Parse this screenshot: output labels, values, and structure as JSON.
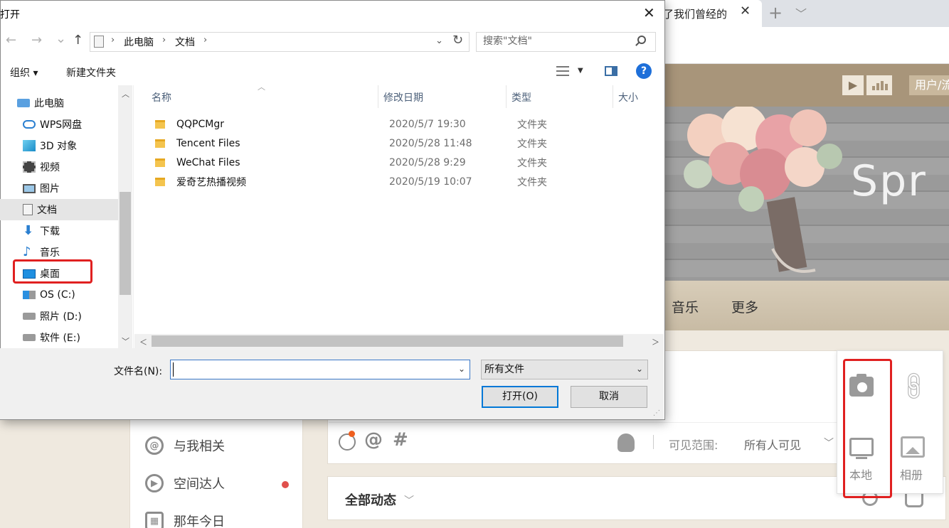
{
  "browser": {
    "tab_title": "了我们曾经的",
    "tab_close": "✕",
    "new_tab": "+",
    "tab_menu": "﹀"
  },
  "qzone": {
    "header_user": "用户/流",
    "banner_text": "Spr",
    "nav": [
      "音乐",
      "更多"
    ],
    "sidebar": [
      {
        "label": "与我相关",
        "icon": "at-icon"
      },
      {
        "label": "空间达人",
        "icon": "play-circle-icon"
      },
      {
        "label": "那年今日",
        "icon": "calendar-icon"
      }
    ],
    "visibility_label": "可见范围:",
    "visibility_value": "所有人可见",
    "feed_title": "全部动态",
    "popup": {
      "local_label": "本地",
      "album_label": "相册"
    },
    "colors": {
      "highlight": "#e02020",
      "header": "#a8957a"
    }
  },
  "dialog": {
    "title": "打开",
    "close": "✕",
    "nav": {
      "back": "←",
      "forward": "→",
      "recent": "⌄",
      "up": "↑"
    },
    "breadcrumb": [
      "此电脑",
      "文档"
    ],
    "breadcrumb_sep": "›",
    "refresh": "↻",
    "search_placeholder": "搜索\"文档\"",
    "toolbar": {
      "organize": "组织 ▾",
      "new_folder": "新建文件夹",
      "help": "?"
    },
    "tree": [
      {
        "label": "此电脑",
        "icon": "computer-icon"
      },
      {
        "label": "WPS网盘",
        "icon": "cloud-icon"
      },
      {
        "label": "3D 对象",
        "icon": "cube-icon"
      },
      {
        "label": "视频",
        "icon": "video-icon"
      },
      {
        "label": "图片",
        "icon": "picture-icon"
      },
      {
        "label": "文档",
        "icon": "document-icon",
        "selected": true
      },
      {
        "label": "下载",
        "icon": "download-icon"
      },
      {
        "label": "音乐",
        "icon": "music-icon"
      },
      {
        "label": "桌面",
        "icon": "desktop-icon"
      },
      {
        "label": "OS (C:)",
        "icon": "windows-drive-icon"
      },
      {
        "label": "照片 (D:)",
        "icon": "drive-icon"
      },
      {
        "label": "软件 (E:)",
        "icon": "drive-icon"
      }
    ],
    "columns": [
      "名称",
      "修改日期",
      "类型",
      "大小"
    ],
    "files": [
      {
        "name": "QQPCMgr",
        "date": "2020/5/7 19:30",
        "type": "文件夹"
      },
      {
        "name": "Tencent Files",
        "date": "2020/5/28 11:48",
        "type": "文件夹"
      },
      {
        "name": "WeChat Files",
        "date": "2020/5/28 9:29",
        "type": "文件夹"
      },
      {
        "name": "爱奇艺热播视频",
        "date": "2020/5/19 10:07",
        "type": "文件夹"
      }
    ],
    "filename_label": "文件名(N):",
    "filename_value": "",
    "filetype_value": "所有文件",
    "open_button": "打开(O)",
    "cancel_button": "取消",
    "colors": {
      "accent": "#0078d7",
      "folder": "#f4c44e"
    }
  }
}
